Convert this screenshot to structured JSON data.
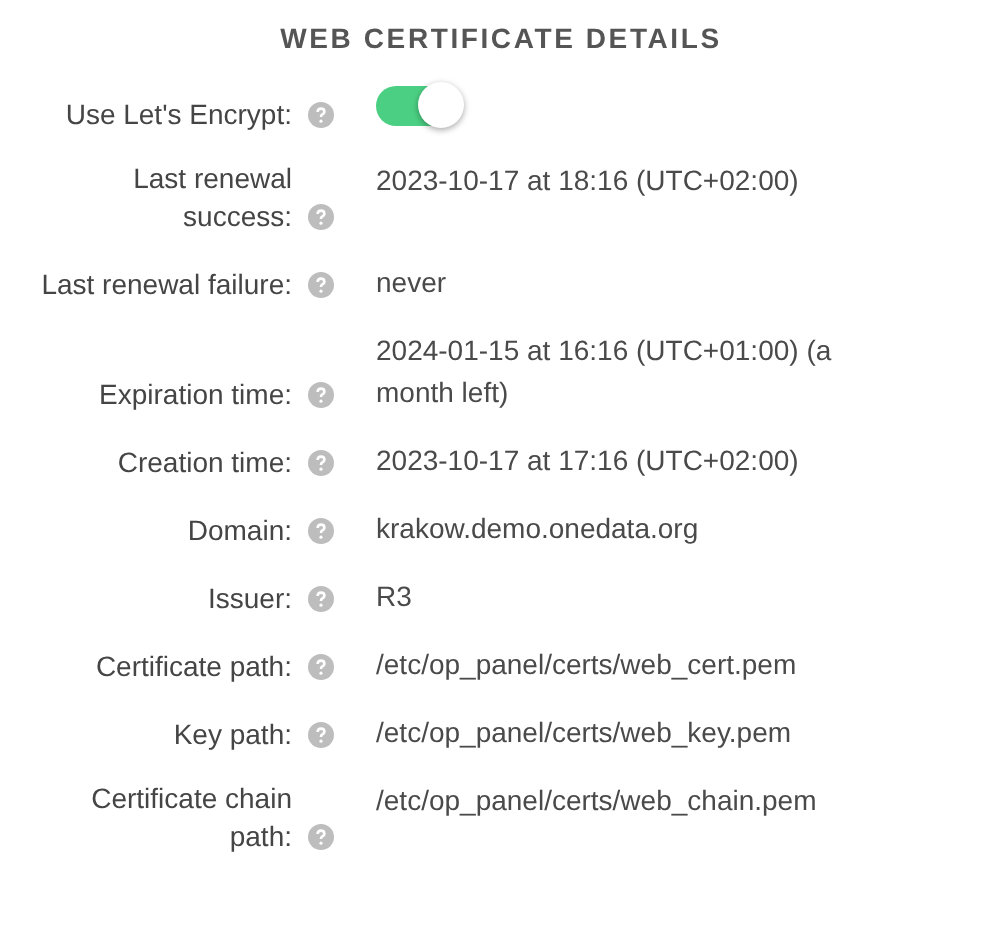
{
  "title": "WEB CERTIFICATE DETAILS",
  "fields": [
    {
      "kind": "toggle",
      "label": "Use Let's Encrypt:",
      "on": true
    },
    {
      "kind": "text",
      "label": "Last renewal\nsuccess:",
      "value": "2023-10-17 at 18:16 (UTC+02:00)"
    },
    {
      "kind": "text",
      "label": "Last renewal failure:",
      "value": "never"
    },
    {
      "kind": "text",
      "label": "Expiration time:",
      "value": "2024-01-15 at 16:16 (UTC+01:00) (a month left)"
    },
    {
      "kind": "text",
      "label": "Creation time:",
      "value": "2023-10-17 at 17:16 (UTC+02:00)"
    },
    {
      "kind": "text",
      "label": "Domain:",
      "value": "krakow.demo.onedata.org"
    },
    {
      "kind": "text",
      "label": "Issuer:",
      "value": "R3"
    },
    {
      "kind": "text",
      "label": "Certificate path:",
      "value": "/etc/op_panel/certs/web_cert.pem"
    },
    {
      "kind": "text",
      "label": "Key path:",
      "value": "/etc/op_panel/certs/web_key.pem"
    },
    {
      "kind": "text",
      "label": "Certificate chain\npath:",
      "value": "/etc/op_panel/certs/web_chain.pem"
    }
  ]
}
